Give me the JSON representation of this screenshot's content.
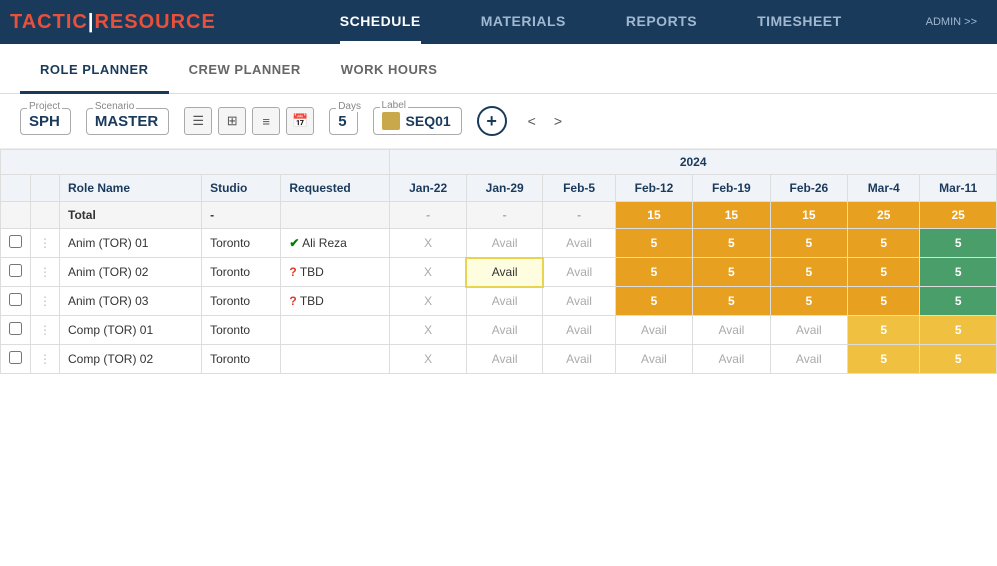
{
  "logo": {
    "tactic": "TACTIC",
    "separator": "|",
    "resource": "RESOURCE"
  },
  "admin_label": "ADMIN >>",
  "nav": {
    "links": [
      {
        "id": "schedule",
        "label": "SCHEDULE",
        "active": true
      },
      {
        "id": "materials",
        "label": "MATERIALS",
        "active": false
      },
      {
        "id": "reports",
        "label": "REPORTS",
        "active": false
      },
      {
        "id": "timesheet",
        "label": "TIMESHEET",
        "active": false
      }
    ]
  },
  "sub_tabs": [
    {
      "id": "role-planner",
      "label": "ROLE PLANNER",
      "active": true
    },
    {
      "id": "crew-planner",
      "label": "CREW PLANNER",
      "active": false
    },
    {
      "id": "work-hours",
      "label": "WORK HOURS",
      "active": false
    }
  ],
  "toolbar": {
    "project_label": "Project",
    "project_value": "SPH",
    "scenario_label": "Scenario",
    "scenario_value": "MASTER",
    "days_label": "Days",
    "days_value": "5",
    "label_label": "Label",
    "label_value": "SEQ01",
    "add_label": "+",
    "nav_prev": "<",
    "nav_next": ">"
  },
  "table": {
    "year": "2024",
    "headers": [
      "",
      "",
      "Role Name",
      "Studio",
      "Requested",
      "Jan-22",
      "Jan-29",
      "Feb-5",
      "Feb-12",
      "Feb-19",
      "Feb-26",
      "Mar-4",
      "Mar-11"
    ],
    "total_row": {
      "label": "Total",
      "studio": "-",
      "dates": [
        "-",
        "-",
        "-",
        "15",
        "15",
        "15",
        "25",
        "25"
      ]
    },
    "rows": [
      {
        "id": 1,
        "role": "Anim (TOR) 01",
        "studio": "Toronto",
        "requested_icon": "check",
        "requested": "Ali Reza",
        "jan22": "X",
        "jan29": "Avail",
        "feb5": "Avail",
        "feb12": "5",
        "feb19": "5",
        "feb26": "5",
        "mar4": "5",
        "mar11": "5",
        "mar4_class": "orange",
        "feb12_class": "orange",
        "feb19_class": "orange",
        "feb26_class": "orange",
        "mar11_class": "green"
      },
      {
        "id": 2,
        "role": "Anim (TOR) 02",
        "studio": "Toronto",
        "requested_icon": "warn",
        "requested": "TBD",
        "jan22": "X",
        "jan29": "Avail",
        "feb5": "Avail",
        "feb12": "5",
        "feb19": "5",
        "feb26": "5",
        "mar4": "5",
        "mar11": "5",
        "jan29_highlight": true,
        "feb12_class": "orange",
        "feb19_class": "orange",
        "feb26_class": "orange",
        "mar4_class": "orange",
        "mar11_class": "green"
      },
      {
        "id": 3,
        "role": "Anim (TOR) 03",
        "studio": "Toronto",
        "requested_icon": "warn",
        "requested": "TBD",
        "jan22": "X",
        "jan29": "Avail",
        "feb5": "Avail",
        "feb12": "5",
        "feb19": "5",
        "feb26": "5",
        "mar4": "5",
        "mar11": "5",
        "feb12_class": "orange",
        "feb19_class": "orange",
        "feb26_class": "orange",
        "mar4_class": "orange",
        "mar11_class": "green"
      },
      {
        "id": 4,
        "role": "Comp (TOR) 01",
        "studio": "Toronto",
        "requested_icon": "none",
        "requested": "",
        "jan22": "X",
        "jan29": "Avail",
        "feb5": "Avail",
        "feb12": "Avail",
        "feb19": "Avail",
        "feb26": "Avail",
        "mar4": "5",
        "mar11": "5",
        "mar4_class": "yellow",
        "mar11_class": "yellow"
      },
      {
        "id": 5,
        "role": "Comp (TOR) 02",
        "studio": "Toronto",
        "requested_icon": "none",
        "requested": "",
        "jan22": "X",
        "jan29": "Avail",
        "feb5": "Avail",
        "feb12": "Avail",
        "feb19": "Avail",
        "feb26": "Avail",
        "mar4": "5",
        "mar11": "5",
        "mar4_class": "yellow",
        "mar11_class": "yellow"
      }
    ]
  }
}
